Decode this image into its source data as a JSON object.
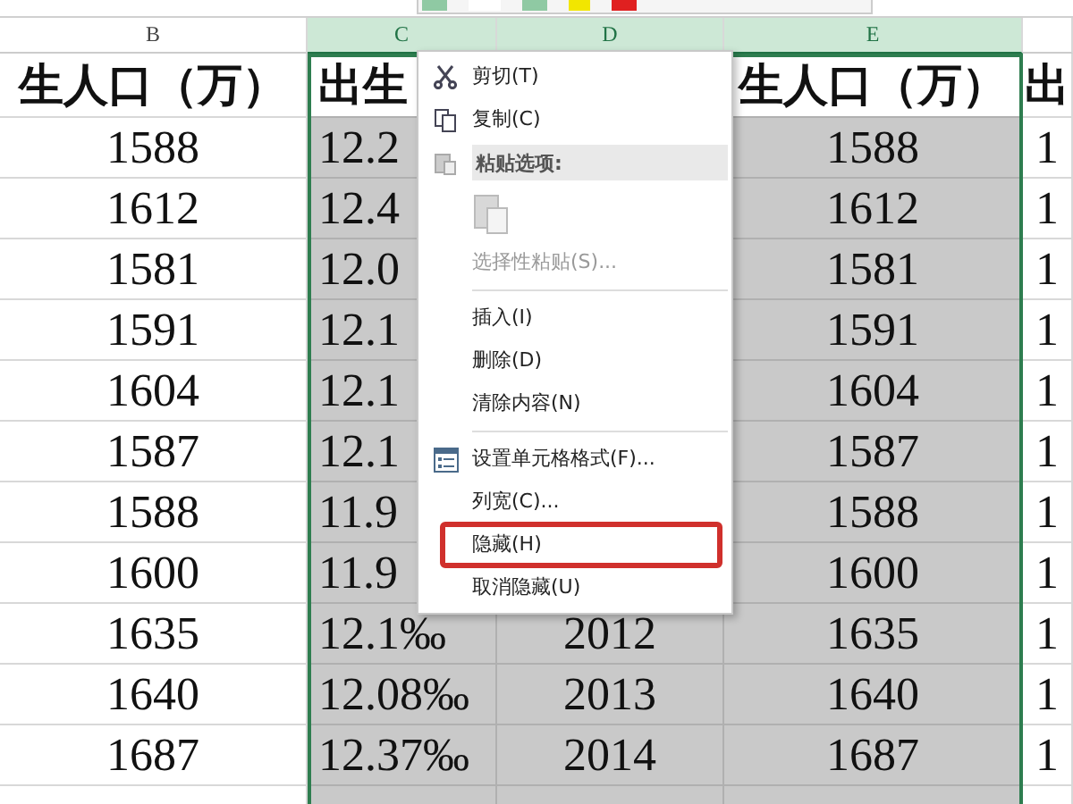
{
  "columns": [
    {
      "letter": "B",
      "selected": false
    },
    {
      "letter": "C",
      "selected": true
    },
    {
      "letter": "D",
      "selected": true
    },
    {
      "letter": "E",
      "selected": true
    },
    {
      "selected": false
    }
  ],
  "header_row": {
    "cells": [
      "生人口（万）",
      "出生",
      null,
      "生人口（万）",
      "出"
    ]
  },
  "rows": [
    {
      "cells": [
        "1588",
        "12.2",
        null,
        "1588",
        "1"
      ]
    },
    {
      "cells": [
        "1612",
        "12.4",
        null,
        "1612",
        "1"
      ]
    },
    {
      "cells": [
        "1581",
        "12.0",
        null,
        "1581",
        "1"
      ]
    },
    {
      "cells": [
        "1591",
        "12.1",
        null,
        "1591",
        "1"
      ]
    },
    {
      "cells": [
        "1604",
        "12.1",
        null,
        "1604",
        "1"
      ]
    },
    {
      "cells": [
        "1587",
        "12.1",
        null,
        "1587",
        "1"
      ]
    },
    {
      "cells": [
        "1588",
        "11.9",
        null,
        "1588",
        "1"
      ]
    },
    {
      "cells": [
        "1600",
        "11.9",
        null,
        "1600",
        "1"
      ]
    },
    {
      "cells": [
        "1635",
        "12.1‰",
        "2012",
        "1635",
        "1"
      ]
    },
    {
      "cells": [
        "1640",
        "12.08‰",
        "2013",
        "1640",
        "1"
      ]
    },
    {
      "cells": [
        "1687",
        "12.37‰",
        "2014",
        "1687",
        "1"
      ]
    },
    {
      "cells": [
        null,
        null,
        null,
        null,
        null
      ]
    }
  ],
  "context_menu": {
    "items": [
      {
        "kind": "cut",
        "label": "剪切(T)",
        "disabled": false,
        "annotated": false
      },
      {
        "kind": "copy",
        "label": "复制(C)",
        "disabled": false,
        "annotated": false
      },
      {
        "kind": "header",
        "label": "粘贴选项:"
      },
      {
        "kind": "paste"
      },
      {
        "kind": "item",
        "label": "选择性粘贴(S)...",
        "disabled": true,
        "annotated": false
      },
      {
        "kind": "separator"
      },
      {
        "kind": "item",
        "label": "插入(I)",
        "disabled": false,
        "annotated": false
      },
      {
        "kind": "item",
        "label": "删除(D)",
        "disabled": false,
        "annotated": false
      },
      {
        "kind": "item",
        "label": "清除内容(N)",
        "disabled": false,
        "annotated": false
      },
      {
        "kind": "separator"
      },
      {
        "kind": "format",
        "label": "设置单元格格式(F)...",
        "disabled": false,
        "annotated": false
      },
      {
        "kind": "item",
        "label": "列宽(C)...",
        "disabled": false,
        "annotated": false
      },
      {
        "kind": "item",
        "label": "隐藏(H)",
        "disabled": false,
        "annotated": true
      },
      {
        "kind": "item",
        "label": "取消隐藏(U)",
        "disabled": false,
        "annotated": false
      }
    ]
  }
}
